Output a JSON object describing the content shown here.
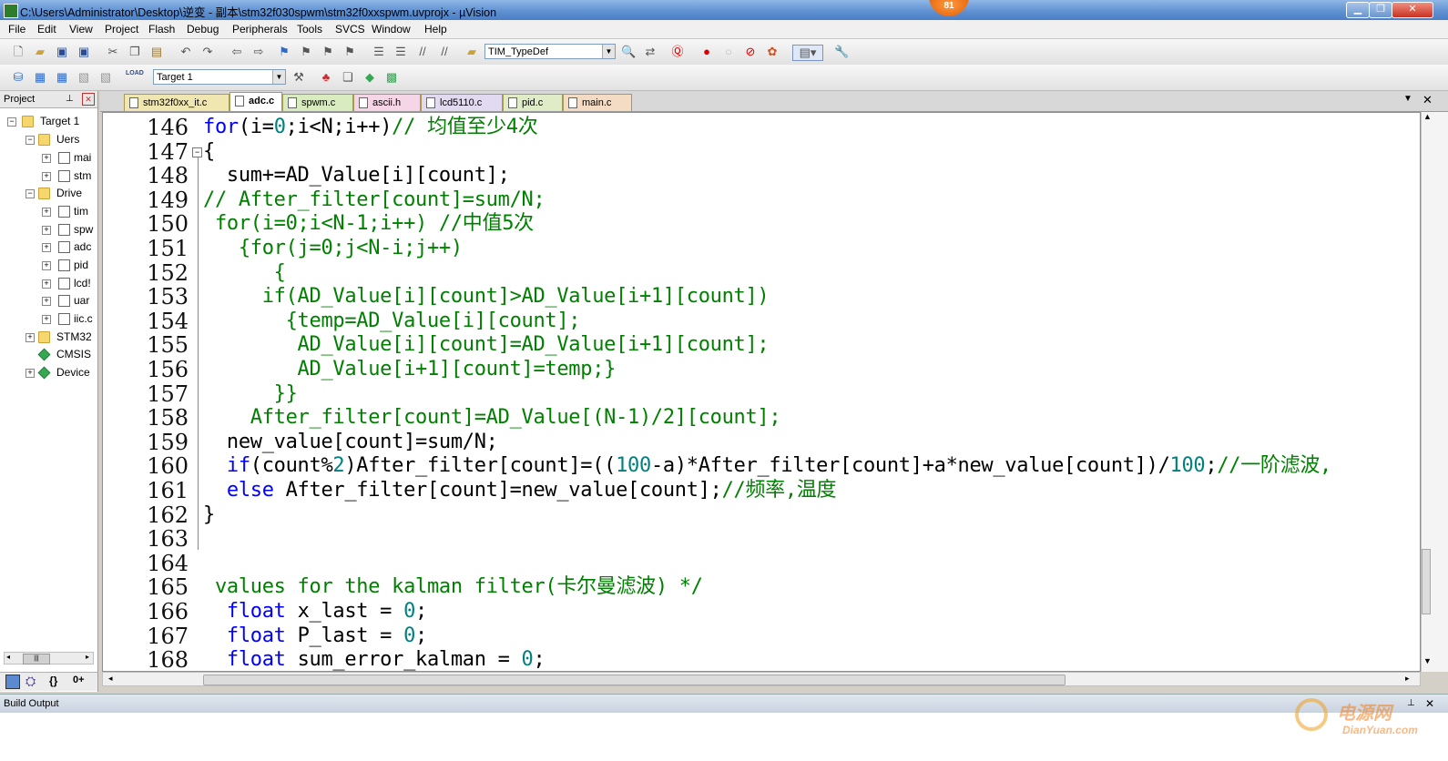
{
  "window": {
    "title": "C:\\Users\\Administrator\\Desktop\\逆变 - 副本\\stm32f030spwm\\stm32f0xxspwm.uvprojx - µVision",
    "badge": "81"
  },
  "menu": [
    "File",
    "Edit",
    "View",
    "Project",
    "Flash",
    "Debug",
    "Peripherals",
    "Tools",
    "SVCS",
    "Window",
    "Help"
  ],
  "toolbar": {
    "find_combo": "TIM_TypeDef",
    "target_combo": "Target 1",
    "load_label": "LOAD"
  },
  "project": {
    "header": "Project",
    "tree": [
      {
        "label": "Target 1",
        "icon": "target-icon",
        "expanded": true
      },
      {
        "label": "Uers",
        "icon": "folder-icon",
        "expanded": true
      },
      {
        "label": "mai",
        "icon": "file-icon"
      },
      {
        "label": "stm",
        "icon": "file-icon"
      },
      {
        "label": "Drive",
        "icon": "folder-icon",
        "expanded": true
      },
      {
        "label": "tim",
        "icon": "file-icon"
      },
      {
        "label": "spw",
        "icon": "file-icon"
      },
      {
        "label": "adc",
        "icon": "file-icon"
      },
      {
        "label": "pid",
        "icon": "file-icon"
      },
      {
        "label": "lcd!",
        "icon": "file-icon"
      },
      {
        "label": "uar",
        "icon": "file-icon"
      },
      {
        "label": "iic.c",
        "icon": "file-icon"
      },
      {
        "label": "STM32",
        "icon": "folder-icon",
        "expanded": false
      },
      {
        "label": "CMSIS",
        "icon": "component-icon"
      },
      {
        "label": "Device",
        "icon": "component-icon",
        "expanded": false
      }
    ]
  },
  "tabs": [
    {
      "label": "stm32f0xx_it.c",
      "active": false
    },
    {
      "label": "adc.c",
      "active": true
    },
    {
      "label": "spwm.c",
      "active": false
    },
    {
      "label": "ascii.h",
      "active": false
    },
    {
      "label": "lcd5110.c",
      "active": false
    },
    {
      "label": "pid.c",
      "active": false
    },
    {
      "label": "main.c",
      "active": false
    }
  ],
  "editor": {
    "lines": [
      {
        "n": "146",
        "segs": [
          {
            "t": "for",
            "c": "kw"
          },
          {
            "t": "(i="
          },
          {
            "t": "0",
            "c": "nm"
          },
          {
            "t": ";i<N;i++)"
          },
          {
            "t": "// 均值至少4次",
            "c": "cm"
          }
        ]
      },
      {
        "n": "147",
        "segs": [
          {
            "t": "{"
          }
        ]
      },
      {
        "n": "148",
        "segs": [
          {
            "t": "  sum+=AD_Value[i][count];"
          }
        ]
      },
      {
        "n": "149",
        "segs": [
          {
            "t": "// After_filter[count]=sum/N;",
            "c": "cm"
          }
        ]
      },
      {
        "n": "150",
        "segs": [
          {
            "t": " for(i=0;i<N-1;i++) //中值5次",
            "c": "cm"
          }
        ]
      },
      {
        "n": "151",
        "segs": [
          {
            "t": "   {for(j=0;j<N-i;j++)",
            "c": "cm"
          }
        ]
      },
      {
        "n": "152",
        "segs": [
          {
            "t": "      {",
            "c": "cm"
          }
        ]
      },
      {
        "n": "153",
        "segs": [
          {
            "t": "     if(AD_Value[i][count]>AD_Value[i+1][count])",
            "c": "cm"
          }
        ]
      },
      {
        "n": "154",
        "segs": [
          {
            "t": "       {temp=AD_Value[i][count];",
            "c": "cm"
          }
        ]
      },
      {
        "n": "155",
        "segs": [
          {
            "t": "        AD_Value[i][count]=AD_Value[i+1][count];",
            "c": "cm"
          }
        ]
      },
      {
        "n": "156",
        "segs": [
          {
            "t": "        AD_Value[i+1][count]=temp;}",
            "c": "cm"
          }
        ]
      },
      {
        "n": "157",
        "segs": [
          {
            "t": "      }}",
            "c": "cm"
          }
        ]
      },
      {
        "n": "158",
        "segs": [
          {
            "t": "    After_filter[count]=AD_Value[(N-1)/2][count];",
            "c": "cm"
          }
        ]
      },
      {
        "n": "159",
        "segs": [
          {
            "t": "  new_value[count]=sum/N;"
          }
        ]
      },
      {
        "n": "160",
        "segs": [
          {
            "t": "  "
          },
          {
            "t": "if",
            "c": "kw"
          },
          {
            "t": "(count%"
          },
          {
            "t": "2",
            "c": "nm"
          },
          {
            "t": ")After_filter[count]=(("
          },
          {
            "t": "100",
            "c": "nm"
          },
          {
            "t": "-a)*After_filter[count]+a*new_value[count])/"
          },
          {
            "t": "100",
            "c": "nm"
          },
          {
            "t": ";"
          },
          {
            "t": "//一阶滤波,",
            "c": "cm"
          }
        ]
      },
      {
        "n": "161",
        "segs": [
          {
            "t": "  "
          },
          {
            "t": "else",
            "c": "kw"
          },
          {
            "t": " After_filter[count]=new_value[count];"
          },
          {
            "t": "//频率,温度",
            "c": "cm"
          }
        ]
      },
      {
        "n": "162",
        "segs": [
          {
            "t": "}"
          }
        ]
      },
      {
        "n": "163",
        "segs": [
          {
            "t": ""
          }
        ]
      },
      {
        "n": "164",
        "segs": [
          {
            "t": ""
          }
        ]
      },
      {
        "n": "165",
        "segs": [
          {
            "t": " values for the kalman filter(卡尔曼滤波) */",
            "c": "cm"
          }
        ]
      },
      {
        "n": "166",
        "segs": [
          {
            "t": "  "
          },
          {
            "t": "float",
            "c": "kw"
          },
          {
            "t": " x_last = "
          },
          {
            "t": "0",
            "c": "nm"
          },
          {
            "t": ";"
          }
        ]
      },
      {
        "n": "167",
        "segs": [
          {
            "t": "  "
          },
          {
            "t": "float",
            "c": "kw"
          },
          {
            "t": " P_last = "
          },
          {
            "t": "0",
            "c": "nm"
          },
          {
            "t": ";"
          }
        ]
      },
      {
        "n": "168",
        "segs": [
          {
            "t": "  "
          },
          {
            "t": "float",
            "c": "kw"
          },
          {
            "t": " sum_error_kalman = "
          },
          {
            "t": "0",
            "c": "nm"
          },
          {
            "t": ";"
          }
        ]
      }
    ]
  },
  "build": {
    "header": "Build Output"
  },
  "watermark": {
    "cn": "电源网",
    "en": "DianYuan.com"
  }
}
